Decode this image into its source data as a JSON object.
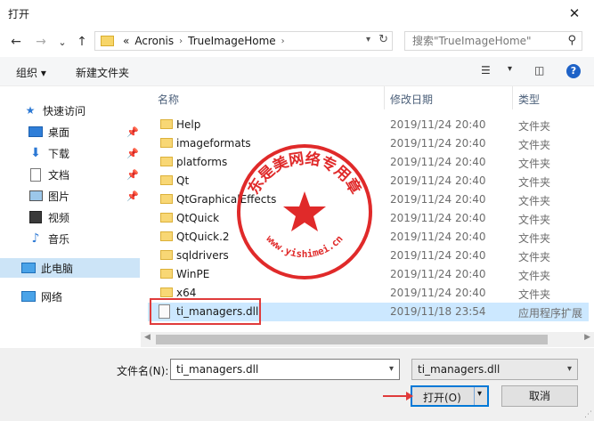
{
  "window": {
    "title": "打开",
    "close": "✕"
  },
  "nav": {
    "back": "←",
    "forward": "→",
    "recent": "⌄",
    "up": "↑"
  },
  "address": {
    "prefix": "«",
    "segments": [
      "Acronis",
      "TrueImageHome"
    ],
    "sep": "›"
  },
  "search": {
    "placeholder": "搜索\"TrueImageHome\""
  },
  "toolbar": {
    "organize": "组织",
    "new_folder": "新建文件夹",
    "help": "?"
  },
  "sidebar": {
    "quick_access": "快速访问",
    "items": [
      {
        "label": "桌面",
        "pinned": true
      },
      {
        "label": "下载",
        "pinned": true
      },
      {
        "label": "文档",
        "pinned": true
      },
      {
        "label": "图片",
        "pinned": true
      },
      {
        "label": "视频",
        "pinned": false
      },
      {
        "label": "音乐",
        "pinned": false
      }
    ],
    "this_pc": "此电脑",
    "network": "网络"
  },
  "columns": {
    "name": "名称",
    "date": "修改日期",
    "type": "类型"
  },
  "files": [
    {
      "name": "Help",
      "date": "2019/11/24 20:40",
      "type": "文件夹"
    },
    {
      "name": "imageformats",
      "date": "2019/11/24 20:40",
      "type": "文件夹"
    },
    {
      "name": "platforms",
      "date": "2019/11/24 20:40",
      "type": "文件夹"
    },
    {
      "name": "Qt",
      "date": "2019/11/24 20:40",
      "type": "文件夹"
    },
    {
      "name": "QtGraphicalEffects",
      "date": "2019/11/24 20:40",
      "type": "文件夹"
    },
    {
      "name": "QtQuick",
      "date": "2019/11/24 20:40",
      "type": "文件夹"
    },
    {
      "name": "QtQuick.2",
      "date": "2019/11/24 20:40",
      "type": "文件夹"
    },
    {
      "name": "sqldrivers",
      "date": "2019/11/24 20:40",
      "type": "文件夹"
    },
    {
      "name": "WinPE",
      "date": "2019/11/24 20:40",
      "type": "文件夹"
    },
    {
      "name": "x64",
      "date": "2019/11/24 20:40",
      "type": "文件夹"
    },
    {
      "name": "ti_managers.dll",
      "date": "2019/11/18 23:54",
      "type": "应用程序扩展"
    }
  ],
  "bottom": {
    "filename_label": "文件名(N):",
    "filename_value": "ti_managers.dll",
    "filetype_value": "ti_managers.dll",
    "open_label": "打开(O)",
    "cancel_label": "取消"
  },
  "stamp": {
    "top_text": "东是美网络专用章",
    "bottom_text": "www.yishimei.cn"
  },
  "colors": {
    "accent": "#0078d7",
    "selection": "#cce8ff",
    "annotation": "#e03b3b"
  }
}
